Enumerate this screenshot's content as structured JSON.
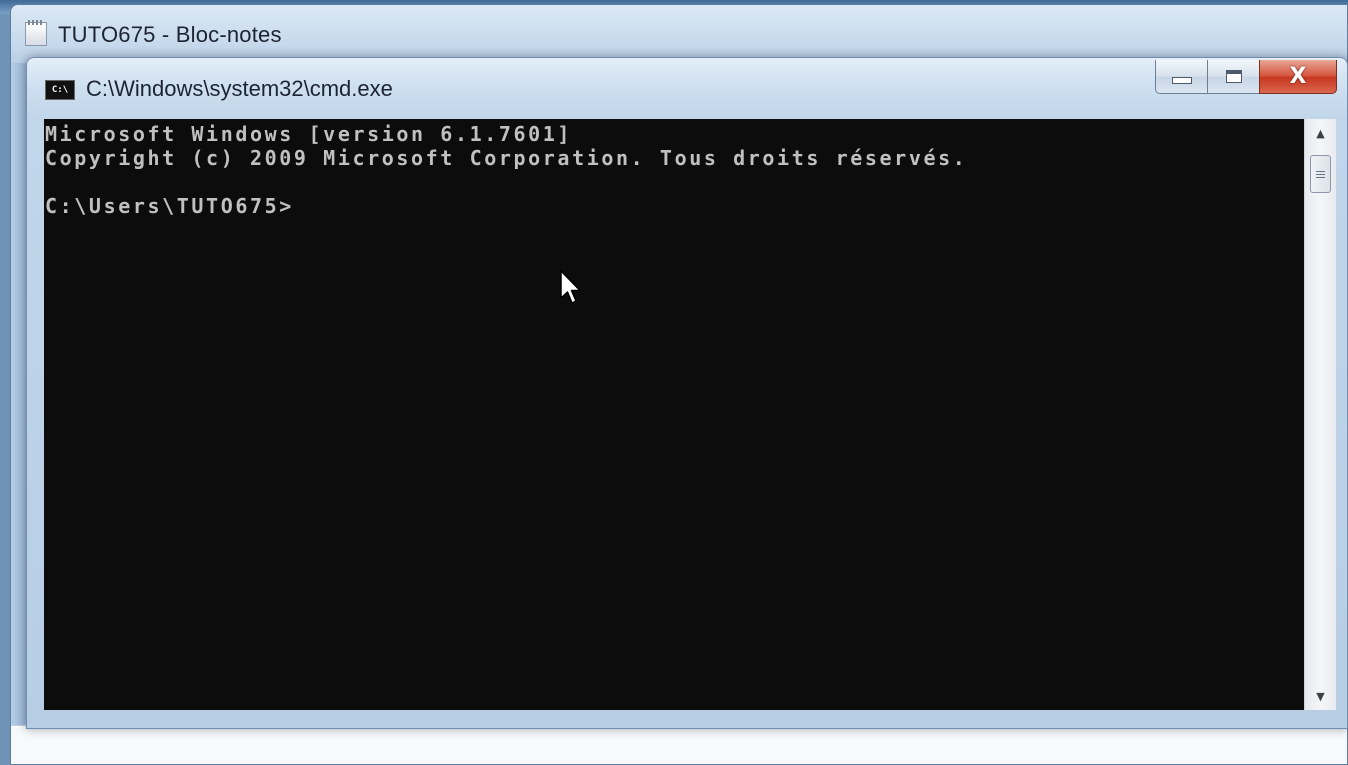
{
  "notepad": {
    "title": "TUTO675 - Bloc-notes",
    "icon": "notepad-icon"
  },
  "cmd": {
    "title": "C:\\Windows\\system32\\cmd.exe",
    "icon_text": "C:\\",
    "buttons": {
      "minimize": "minimize-icon",
      "maximize": "maximize-icon",
      "close": "close-icon",
      "close_glyph": "X"
    },
    "console_lines": [
      "Microsoft Windows [version 6.1.7601]",
      "Copyright (c) 2009 Microsoft Corporation. Tous droits réservés.",
      "",
      "C:\\Users\\TUTO675>"
    ],
    "colors": {
      "console_background": "#0c0c0c",
      "console_text": "#c0c0c0",
      "close_button": "#c5361e"
    }
  }
}
